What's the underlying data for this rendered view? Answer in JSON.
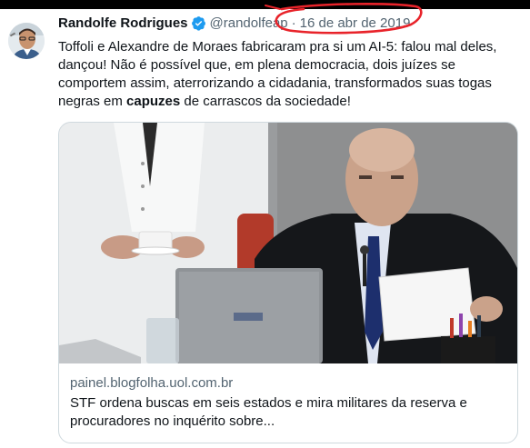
{
  "tweet": {
    "author_name": "Randolfe Rodrigues",
    "handle": "@randolfeap",
    "separator": "·",
    "date": "16 de abr de 2019",
    "text_before_bold": "Toffoli e Alexandre de Moraes fabricaram pra si um AI-5: falou mal deles, dançou! Não é possível que, em plena democracia, dois juízes se comportem assim, aterrorizando a cidadania, transformados suas togas negras em ",
    "text_bold": "capuzes",
    "text_after_bold": " de carrascos da sociedade!",
    "verified_icon": "verified-badge-icon",
    "annotation_color": "#e8232a"
  },
  "card": {
    "domain": "painel.blogfolha.uol.com.br",
    "title": "STF ordena buscas em seis estados e mira militares da reserva e procuradores no inquérito sobre..."
  },
  "colors": {
    "text": "#0f1419",
    "secondary": "#536471",
    "verified": "#1d9bf0",
    "border": "#cfd9de"
  }
}
